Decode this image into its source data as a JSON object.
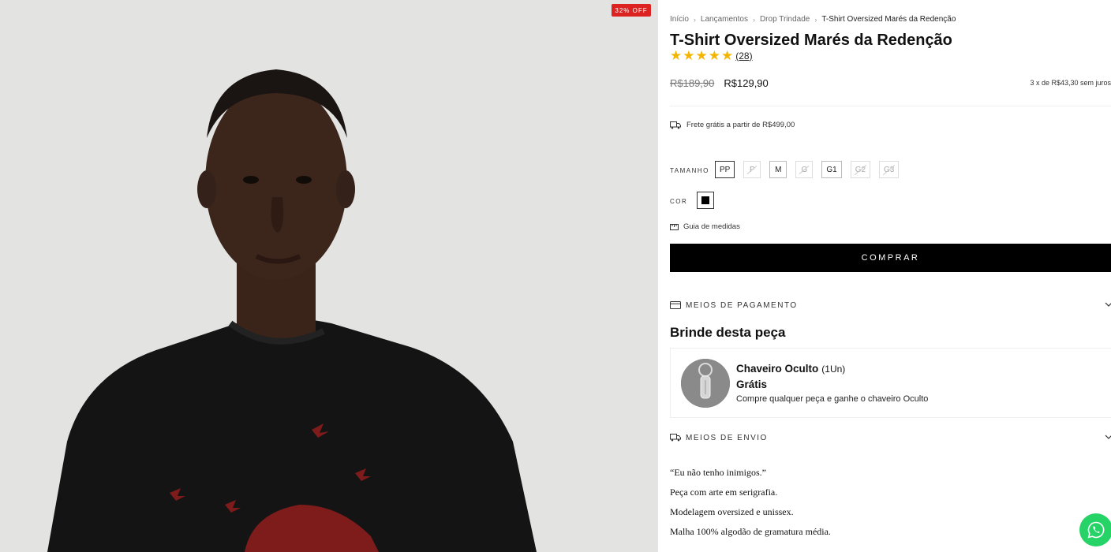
{
  "badge": {
    "discount": "32% OFF"
  },
  "breadcrumb": {
    "items": [
      "Início",
      "Lançamentos",
      "Drop Trindade"
    ],
    "current": "T-Shirt Oversized Marés da Redenção"
  },
  "product": {
    "title": "T-Shirt Oversized Marés da Redenção",
    "rating": 5,
    "reviews_count": "(28)",
    "old_price": "R$189,90",
    "price": "R$129,90",
    "installments": "3 x de R$43,30 sem juros",
    "shipping_free": "Frete grátis a partir de R$499,00"
  },
  "options": {
    "size_label": "Tamanho",
    "sizes": [
      {
        "label": "PP",
        "state": "selected"
      },
      {
        "label": "P",
        "state": "unavailable"
      },
      {
        "label": "M",
        "state": "available"
      },
      {
        "label": "G",
        "state": "unavailable"
      },
      {
        "label": "G1",
        "state": "available"
      },
      {
        "label": "G2",
        "state": "unavailable"
      },
      {
        "label": "G3",
        "state": "unavailable"
      }
    ],
    "color_label": "Cor",
    "color": {
      "value": "#000000"
    },
    "size_guide": "Guia de medidas"
  },
  "buy_button": "COMPRAR",
  "payment_accordion": "MEIOS DE PAGAMENTO",
  "gift": {
    "heading": "Brinde desta peça",
    "name": "Chaveiro Oculto",
    "qty": "(1Un)",
    "free": "Grátis",
    "description": "Compre qualquer peça e ganhe o chaveiro Oculto"
  },
  "shipping_accordion": "MEIOS DE ENVIO",
  "description_lines": [
    "“Eu não tenho inimigos.”",
    "Peça com arte em serigrafia.",
    "Modelagem oversized e unissex.",
    "Malha 100% algodão de gramatura média."
  ],
  "icons": {
    "star": "star-icon",
    "truck": "truck-icon",
    "ruler": "ruler-icon",
    "card": "credit-card-icon",
    "chevron": "chevron-down-icon",
    "whatsapp": "whatsapp-icon"
  },
  "colors": {
    "accent": "#000000",
    "star": "#f2b600",
    "badge": "#dd2222",
    "whatsapp": "#25d366"
  }
}
